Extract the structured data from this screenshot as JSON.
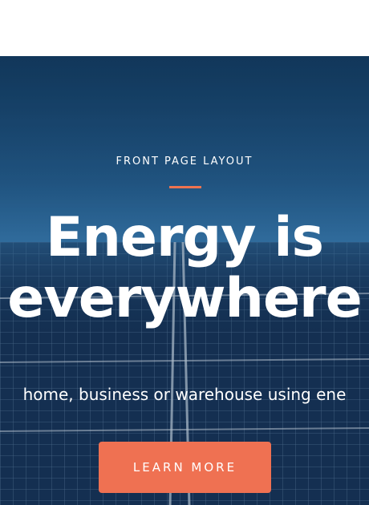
{
  "hero": {
    "eyebrow": "FRONT PAGE LAYOUT",
    "headline_line1": "Energy is",
    "headline_line2": "everywhere",
    "subtext": "home, business or warehouse using ene",
    "cta_label": "LEARN MORE"
  },
  "colors": {
    "accent": "#ee7350",
    "button": "#ef7152",
    "text": "#ffffff",
    "sky": "#2a6aa0"
  }
}
